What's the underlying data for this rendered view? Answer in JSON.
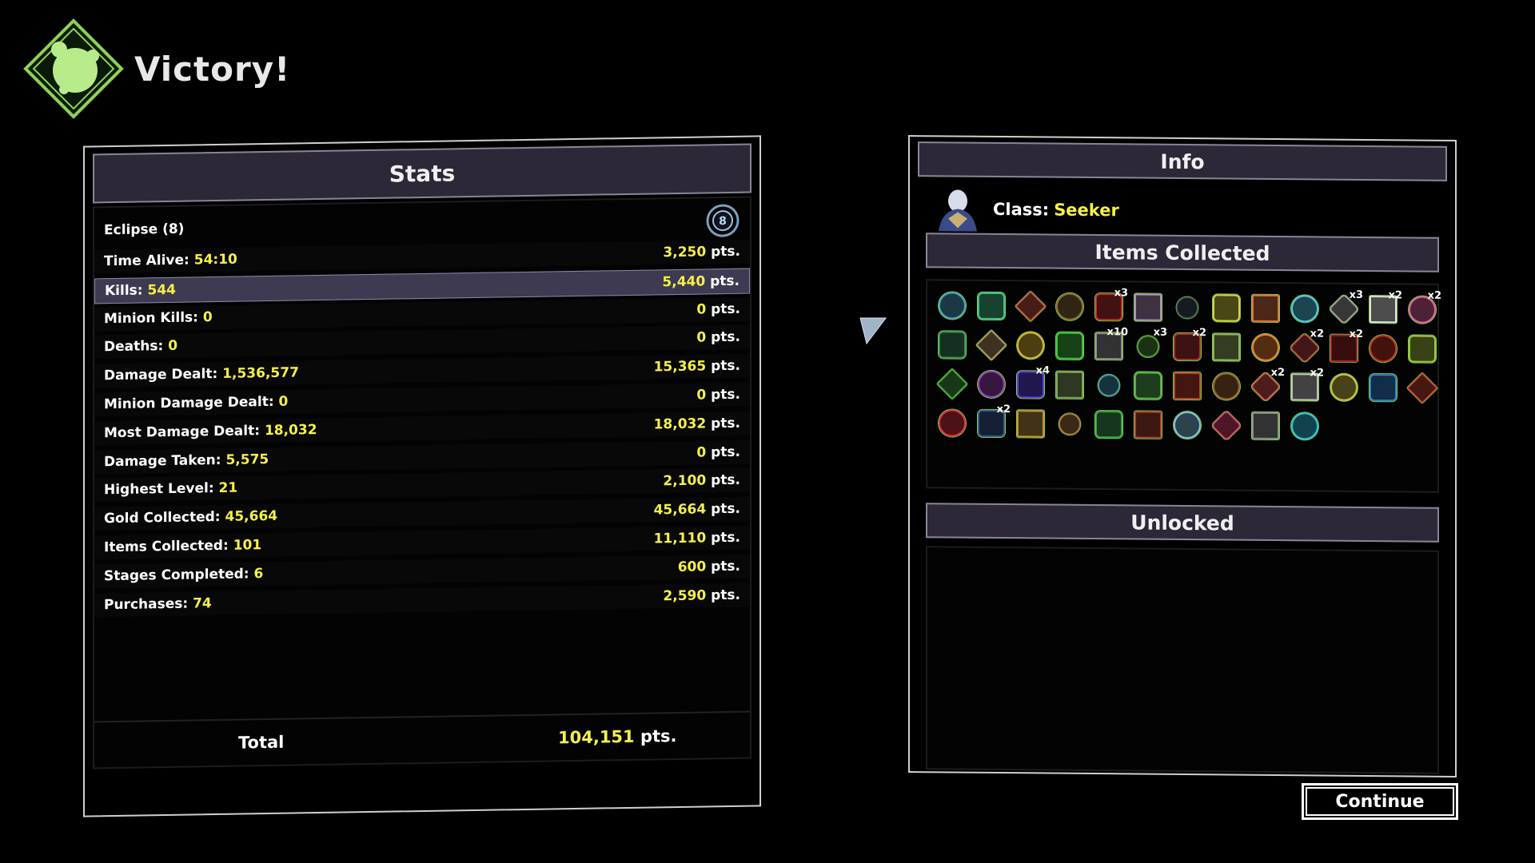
{
  "header": {
    "title": "Victory!",
    "icon": "victory-emblem-icon",
    "accent": "#9fe060"
  },
  "stats": {
    "title": "Stats",
    "eclipse_label": "Eclipse (8)",
    "rows": [
      {
        "label": "Time Alive:",
        "value": "54:10",
        "pts": "3,250",
        "unit": "pts."
      },
      {
        "label": "Kills:",
        "value": "544",
        "pts": "5,440",
        "unit": "pts.",
        "highlighted": true
      },
      {
        "label": "Minion Kills:",
        "value": "0",
        "pts": "0",
        "unit": "pts."
      },
      {
        "label": "Deaths:",
        "value": "0",
        "pts": "0",
        "unit": "pts."
      },
      {
        "label": "Damage Dealt:",
        "value": "1,536,577",
        "pts": "15,365",
        "unit": "pts."
      },
      {
        "label": "Minion Damage Dealt:",
        "value": "0",
        "pts": "0",
        "unit": "pts."
      },
      {
        "label": "Most Damage Dealt:",
        "value": "18,032",
        "pts": "18,032",
        "unit": "pts."
      },
      {
        "label": "Damage Taken:",
        "value": "5,575",
        "pts": "0",
        "unit": "pts."
      },
      {
        "label": "Highest Level:",
        "value": "21",
        "pts": "2,100",
        "unit": "pts."
      },
      {
        "label": "Gold Collected:",
        "value": "45,664",
        "pts": "45,664",
        "unit": "pts."
      },
      {
        "label": "Items Collected:",
        "value": "101",
        "pts": "11,110",
        "unit": "pts."
      },
      {
        "label": "Stages Completed:",
        "value": "6",
        "pts": "600",
        "unit": "pts."
      },
      {
        "label": "Purchases:",
        "value": "74",
        "pts": "2,590",
        "unit": "pts."
      }
    ],
    "total_label": "Total",
    "total_value": "104,151",
    "total_unit": "pts."
  },
  "info": {
    "title": "Info",
    "class_label": "Class:",
    "class_value": "Seeker",
    "items_title": "Items Collected",
    "unlocked_title": "Unlocked",
    "items": [
      {
        "icon": "teapot-item-icon",
        "color": "#4aa3c8",
        "count": ""
      },
      {
        "icon": "green-bird-item-icon",
        "color": "#3fbf8a",
        "count": ""
      },
      {
        "icon": "red-crystal-item-icon",
        "color": "#d05040",
        "count": ""
      },
      {
        "icon": "brown-bag-item-icon",
        "color": "#8a6a3a",
        "count": ""
      },
      {
        "icon": "red-jar-item-icon",
        "color": "#c03030",
        "count": "x3"
      },
      {
        "icon": "box-item-icon",
        "color": "#b090c0",
        "count": ""
      },
      {
        "icon": "dark-book-item-icon",
        "color": "#3a4a5a",
        "count": ""
      },
      {
        "icon": "yellow-claw-item-icon",
        "color": "#d8d040",
        "count": ""
      },
      {
        "icon": "orange-flame-item-icon",
        "color": "#e07040",
        "count": ""
      },
      {
        "icon": "blue-battery-item-icon",
        "color": "#50c8e8",
        "count": ""
      },
      {
        "icon": "skull-item-icon",
        "color": "#a0a0a0",
        "count": "x3"
      },
      {
        "icon": "medkit-item-icon",
        "color": "#e0e0e0",
        "count": "x2"
      },
      {
        "icon": "triangle-item-icon",
        "color": "#e060a0",
        "count": "x2"
      },
      {
        "icon": "green-ring-item-icon",
        "color": "#3a8a5a",
        "count": ""
      },
      {
        "icon": "helmet-item-icon",
        "color": "#b09060",
        "count": ""
      },
      {
        "icon": "gold-coin-item-icon",
        "color": "#e0b030",
        "count": ""
      },
      {
        "icon": "green-orb-item-icon",
        "color": "#40c040",
        "count": ""
      },
      {
        "icon": "grey-canister-item-icon",
        "color": "#909090",
        "count": "x10"
      },
      {
        "icon": "spiral-item-icon",
        "color": "#4a8a3a",
        "count": "x3"
      },
      {
        "icon": "red-beast-item-icon",
        "color": "#b03030",
        "count": "x2"
      },
      {
        "icon": "lizard-item-icon",
        "color": "#90b060",
        "count": ""
      },
      {
        "icon": "orange-magnifier-item-icon",
        "color": "#f08030",
        "count": ""
      },
      {
        "icon": "red-goggles-item-icon",
        "color": "#c04040",
        "count": "x2"
      },
      {
        "icon": "red-tome-item-icon",
        "color": "#a02020",
        "count": "x2"
      },
      {
        "icon": "red-mushroom-item-icon",
        "color": "#c03020",
        "count": ""
      },
      {
        "icon": "green-chain-item-icon",
        "color": "#a0c040",
        "count": ""
      },
      {
        "icon": "green-blade-item-icon",
        "color": "#40a040",
        "count": ""
      },
      {
        "icon": "purple-claw-item-icon",
        "color": "#a040c0",
        "count": ""
      },
      {
        "icon": "purple-creature-item-icon",
        "color": "#6040e0",
        "count": "x4"
      },
      {
        "icon": "syringe-item-icon",
        "color": "#80a060",
        "count": ""
      },
      {
        "icon": "blue-vial-item-icon",
        "color": "#4090b0",
        "count": ""
      },
      {
        "icon": "green-hook-item-icon",
        "color": "#50b050",
        "count": ""
      },
      {
        "icon": "red-wrench-item-icon",
        "color": "#c04030",
        "count": ""
      },
      {
        "icon": "bronze-ring-item-icon",
        "color": "#a06030",
        "count": ""
      },
      {
        "icon": "red-flask-item-icon",
        "color": "#e05050",
        "count": "x2"
      },
      {
        "icon": "grey-scroll-item-icon",
        "color": "#c0c0c0",
        "count": "x2"
      },
      {
        "icon": "yellow-dagger-item-icon",
        "color": "#d0c040",
        "count": ""
      },
      {
        "icon": "blue-feather-item-icon",
        "color": "#3080d0",
        "count": ""
      },
      {
        "icon": "red-rocket-item-icon",
        "color": "#d04030",
        "count": ""
      },
      {
        "icon": "red-link-item-icon",
        "color": "#e03040",
        "count": ""
      },
      {
        "icon": "blue-star-item-icon",
        "color": "#3a5a9a",
        "count": "x2"
      },
      {
        "icon": "turtle-item-icon",
        "color": "#c09040",
        "count": ""
      },
      {
        "icon": "guitar-item-icon",
        "color": "#b07040",
        "count": ""
      },
      {
        "icon": "green-figure-item-icon",
        "color": "#40a050",
        "count": ""
      },
      {
        "icon": "horned-beast-item-icon",
        "color": "#b04030",
        "count": ""
      },
      {
        "icon": "silver-ring-item-icon",
        "color": "#80c0e0",
        "count": ""
      },
      {
        "icon": "pink-gem-item-icon",
        "color": "#e04070",
        "count": ""
      },
      {
        "icon": "grey-pipe-item-icon",
        "color": "#909090",
        "count": ""
      },
      {
        "icon": "cyan-blob-item-icon",
        "color": "#30c0e0",
        "count": ""
      }
    ]
  },
  "continue_label": "Continue"
}
